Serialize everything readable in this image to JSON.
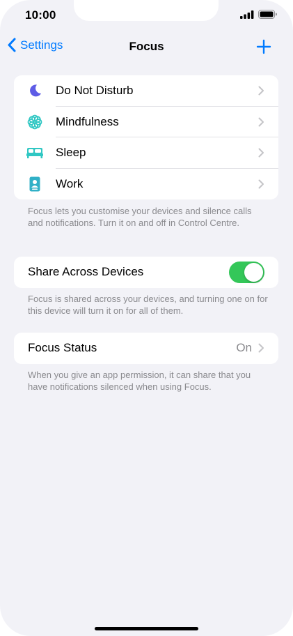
{
  "status_bar": {
    "time": "10:00"
  },
  "nav": {
    "back_label": "Settings",
    "title": "Focus"
  },
  "focus_modes": [
    {
      "label": "Do Not Disturb",
      "icon": "moon-icon",
      "color": "#5e5ce6"
    },
    {
      "label": "Mindfulness",
      "icon": "flower-icon",
      "color": "#30c7c3"
    },
    {
      "label": "Sleep",
      "icon": "bed-icon",
      "color": "#30c7c3"
    },
    {
      "label": "Work",
      "icon": "id-badge-icon",
      "color": "#30b0c7"
    }
  ],
  "focus_footer": "Focus lets you customise your devices and silence calls and notifications. Turn it on and off in Control Centre.",
  "share": {
    "label": "Share Across Devices",
    "enabled": true,
    "footer": "Focus is shared across your devices, and turning one on for this device will turn it on for all of them."
  },
  "status": {
    "label": "Focus Status",
    "value": "On",
    "footer": "When you give an app permission, it can share that you have notifications silenced when using Focus."
  },
  "colors": {
    "accent": "#007aff",
    "toggle_on": "#34c759",
    "background": "#f2f2f7"
  }
}
